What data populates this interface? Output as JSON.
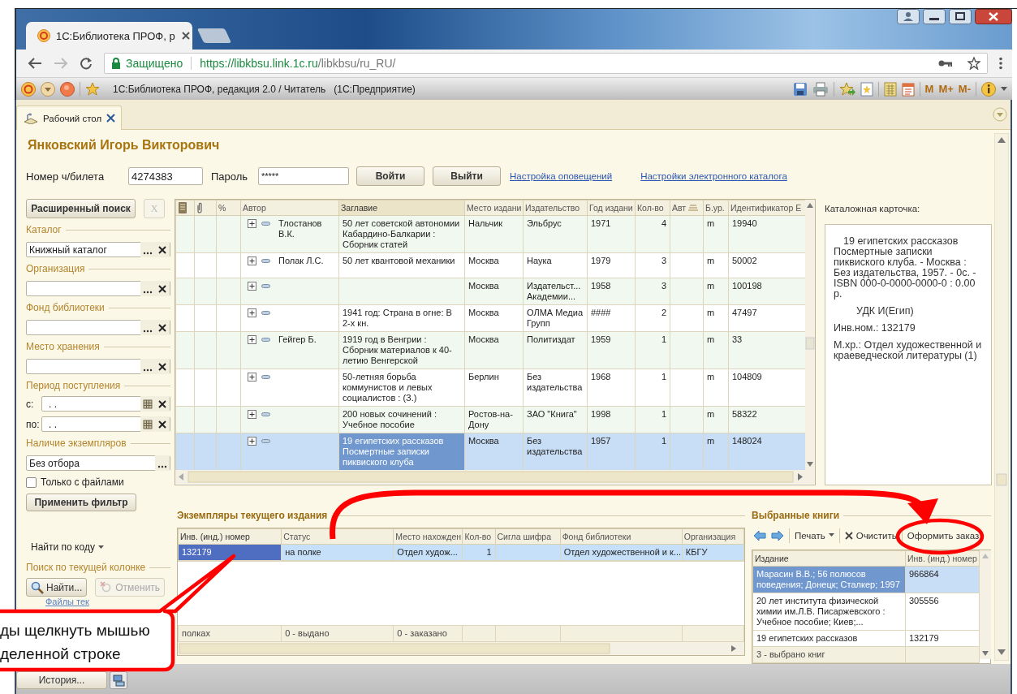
{
  "browser": {
    "tab_title": "1С:Библиотека ПРОФ, р",
    "security": "Защищено",
    "url_scheme": "https://",
    "url_host": "libkbsu.link.1c.ru",
    "url_path": "/libkbsu/ru_RU/"
  },
  "app_toolbar": {
    "title": "1С:Библиотека ПРОФ, редакция 2.0 / Читатель   (1С:Предприятие)",
    "memory_buttons": [
      "M",
      "M+",
      "M-"
    ]
  },
  "tabs": [
    {
      "label": "Рабочий стол",
      "selected": true
    }
  ],
  "reader": {
    "name": "Янковский Игорь Викторович",
    "card_label": "Номер ч/билета",
    "card_number": "4274383",
    "password_label": "Пароль",
    "password": "*****",
    "buttons": [
      "Войти",
      "Выйти"
    ],
    "links": [
      "Настройка оповещений",
      "Настройки электронного каталога"
    ]
  },
  "filters": {
    "search_button": "Расширенный поиск",
    "clear_button": "X",
    "clear_disabled": true,
    "groups": [
      {
        "kind": "select",
        "label": "Каталог",
        "value": "Книжный каталог"
      },
      {
        "kind": "select",
        "label": "Организация"
      },
      {
        "kind": "select",
        "label": "Фонд библиотеки"
      },
      {
        "kind": "select",
        "label": "Место хранения"
      },
      {
        "kind": "period",
        "label": "Период поступления",
        "fields": [
          {
            "label": "с:",
            "value": ". ."
          },
          {
            "label": "по:",
            "value": ". ."
          }
        ]
      },
      {
        "kind": "choice",
        "label": "Наличие экземпляров",
        "value": "Без отбора"
      }
    ],
    "only_files": {
      "label": "Только с файлами",
      "checked": false
    },
    "apply_button": "Применить фильтр",
    "find_by_code": "Найти по коду",
    "column_search": {
      "label": "Поиск по текущей колонке",
      "find": "Найти...",
      "cancel": "Отменить",
      "cancel_disabled": true
    },
    "files_link": "Файлы тек"
  },
  "catalog": {
    "columns": [
      {
        "kind": "doc"
      },
      {
        "kind": "clip"
      },
      {
        "kind": "text",
        "label": "%"
      },
      {
        "kind": "text",
        "label": "Автор",
        "current": false
      },
      {
        "kind": "text",
        "label": "Заглавие",
        "current": true
      },
      {
        "kind": "text",
        "label": "Место издани",
        "current": false
      },
      {
        "kind": "text",
        "label": "Издательство",
        "current": false
      },
      {
        "kind": "text",
        "label": "Год издани",
        "current": false
      },
      {
        "kind": "text",
        "label": "Кол-во",
        "current": false
      },
      {
        "kind": "sort",
        "label": "Авт",
        "current": false
      },
      {
        "kind": "text",
        "label": "Б.ур.",
        "current": false
      },
      {
        "kind": "text",
        "label": "Идентификатор Е",
        "current": false
      }
    ],
    "rows": [
      {
        "selected": false,
        "author": "Тлостанов В.К.",
        "title": "50 лет советской автономии Кабардино-Балкарии : Сборник статей",
        "place": "Нальчик",
        "publisher": "Эльбрус",
        "year": "1971",
        "count": "4",
        "level": "m",
        "id": "19940"
      },
      {
        "selected": false,
        "author": "Полак Л.С.",
        "title": "50 лет квантовой механики",
        "place": "Москва",
        "publisher": "Наука",
        "year": "1979",
        "count": "3",
        "level": "m",
        "id": "50002"
      },
      {
        "selected": false,
        "place": "Москва",
        "publisher": "Издательст... Академии...",
        "year": "1958",
        "count": "3",
        "level": "m",
        "id": "100198"
      },
      {
        "selected": false,
        "title": "1941 год: Страна в огне: В 2-х кн.",
        "place": "Москва",
        "publisher": "ОЛМА Медиа Групп",
        "year": "####",
        "count": "2",
        "level": "m",
        "id": "47497"
      },
      {
        "selected": false,
        "author": "Гейгер Б.",
        "title": "1919 год в Венгрии : Сборник материалов к 40-летию Венгерской",
        "place": "Москва",
        "publisher": "Политиздат",
        "year": "1959",
        "count": "1",
        "level": "m",
        "id": "33"
      },
      {
        "selected": false,
        "title": "50-летняя борьба коммунистов и левых социалистов : (З.)",
        "place": "Берлин",
        "publisher": "Без издательства",
        "year": "1968",
        "count": "1",
        "level": "m",
        "id": "104809"
      },
      {
        "selected": false,
        "title": "200 новых сочинений : Учебное пособие",
        "place": "Ростов-на-Дону",
        "publisher": "ЗАО \"Книга\"",
        "year": "1998",
        "count": "1",
        "level": "m",
        "id": "58322"
      },
      {
        "selected": true,
        "title": "19 египетских рассказов Посмертные записки пиквиского клуба",
        "place": "Москва",
        "publisher": "Без издательства",
        "year": "1957",
        "count": "1",
        "level": "m",
        "id": "148024"
      }
    ]
  },
  "card": {
    "label": "Каталожная карточка:",
    "paragraphs": [
      {
        "kind": "body",
        "text": "19 египетских рассказов Посмертные записки пиквиского клуба. - Москва : Без издательства, 1957. - 0с. - ISBN 000-0-0000-0000-0 : 0.00 р."
      },
      {
        "kind": "udc",
        "text": "УДК И(Егип)"
      },
      {
        "kind": "plain",
        "text": "Инв.ном.: 132179"
      },
      {
        "kind": "plain",
        "text": "М.хр.: Отдел художественной и краеведческой литературы (1)"
      }
    ]
  },
  "copies": {
    "title": "Экземпляры текущего издания",
    "columns": [
      {
        "label": "Инв. (инд.) номер",
        "current": true
      },
      {
        "label": "Статус",
        "current": false
      },
      {
        "label": "Место нахожден",
        "current": false
      },
      {
        "label": "Кол-во",
        "current": false
      },
      {
        "label": "Сигла шифра",
        "current": false
      },
      {
        "label": "Фонд библиотеки",
        "current": false
      },
      {
        "label": "Организация",
        "current": false
      }
    ],
    "rows": [
      {
        "selected": true,
        "cells": [
          "132179",
          "на полке",
          "Отдел худож...",
          "1",
          null,
          "Отдел художественной и к...",
          "КБГУ"
        ]
      }
    ],
    "footer": [
      "полках",
      "0 - выдано",
      "0 - заказано"
    ]
  },
  "selected_books": {
    "title": "Выбранные книги",
    "toolbar": [
      {
        "kind": "back"
      },
      {
        "kind": "forward"
      },
      {
        "kind": "menu",
        "label": "Печать"
      },
      {
        "kind": "clear",
        "label": "Очистить"
      },
      {
        "kind": "action",
        "label": "Оформить заказ"
      }
    ],
    "columns": [
      {
        "label": "Издание",
        "current": true
      },
      {
        "label": "Инв. (инд.) номер",
        "current": false
      }
    ],
    "rows": [
      {
        "selected": true,
        "title": "Марасин В.В.; 56 полюсов поведения; Донецк; Сталкер; 1997",
        "number": "966864"
      },
      {
        "selected": false,
        "title": "20 лет института физической химии им.Л.В. Писаржевского : Учебное пособие; Киев;...",
        "number": "305556"
      },
      {
        "selected": false,
        "title": "19 египетских рассказов",
        "number": "132179"
      }
    ],
    "footer": "3 - выбрано книг"
  },
  "taskbar": {
    "history_button": "История..."
  },
  "annotation": {
    "callout": [
      "ды щелкнуть мышью",
      "деленной строке"
    ]
  }
}
